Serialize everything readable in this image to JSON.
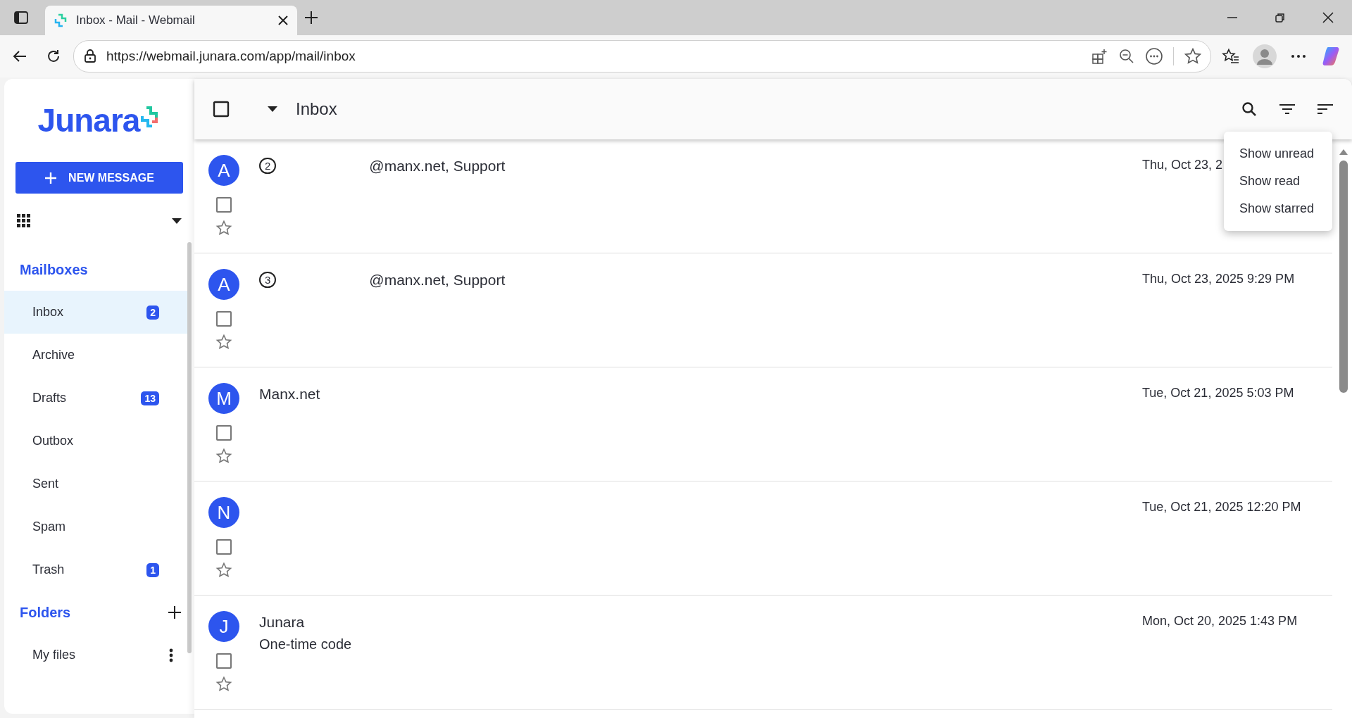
{
  "browser": {
    "tab_title": "Inbox - Mail - Webmail",
    "url": "https://webmail.junara.com/app/mail/inbox"
  },
  "sidebar": {
    "logo": "Junara",
    "new_message": "NEW MESSAGE",
    "mailboxes_heading": "Mailboxes",
    "mailboxes": [
      {
        "label": "Inbox",
        "badge": "2",
        "selected": true
      },
      {
        "label": "Archive",
        "selected": false
      },
      {
        "label": "Drafts",
        "badge": "13",
        "selected": false
      },
      {
        "label": "Outbox",
        "selected": false
      },
      {
        "label": "Sent",
        "selected": false
      },
      {
        "label": "Spam",
        "selected": false
      },
      {
        "label": "Trash",
        "badge": "1",
        "selected": false
      }
    ],
    "folders_heading": "Folders",
    "folders": [
      {
        "label": "My files"
      }
    ]
  },
  "toolbar": {
    "title": "Inbox",
    "select_all_checked": false
  },
  "messages": [
    {
      "avatar": "A",
      "thread_count": "2",
      "sender": "@manx.net, Support",
      "date": "Thu, Oct 23, 2",
      "checked": false,
      "starred": false
    },
    {
      "avatar": "A",
      "thread_count": "3",
      "sender": "@manx.net, Support",
      "date": "Thu, Oct 23, 2025 9:29 PM",
      "checked": false,
      "starred": false
    },
    {
      "avatar": "M",
      "sender": "Manx.net",
      "date": "Tue, Oct 21, 2025 5:03 PM",
      "checked": false,
      "starred": false
    },
    {
      "avatar": "N",
      "date": "Tue, Oct 21, 2025 12:20 PM",
      "checked": false,
      "starred": false
    },
    {
      "avatar": "J",
      "sender": "Junara",
      "subject": "One-time code",
      "date": "Mon, Oct 20, 2025 1:43 PM",
      "checked": false,
      "starred": false
    }
  ],
  "filter_menu": {
    "items": [
      "Show unread",
      "Show read",
      "Show starred"
    ]
  }
}
